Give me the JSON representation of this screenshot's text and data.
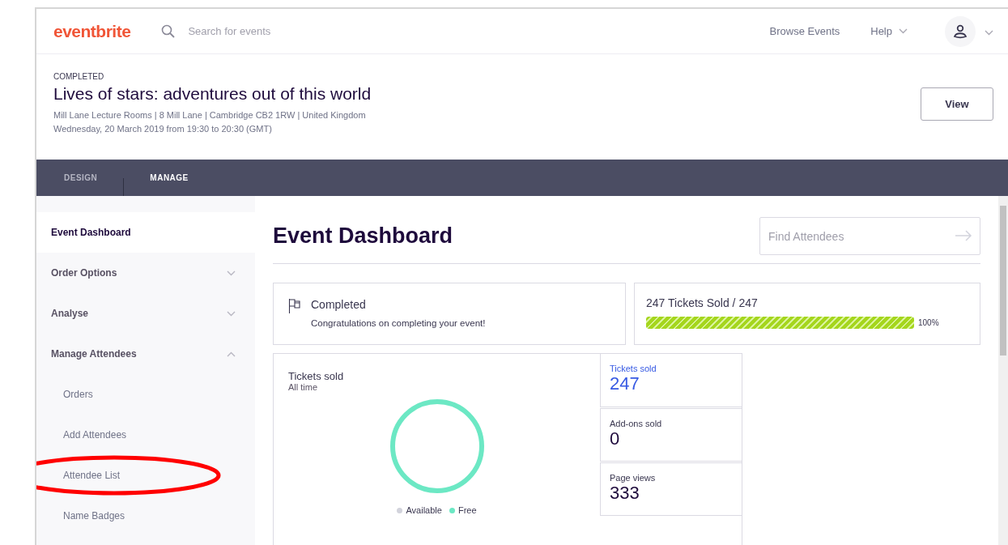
{
  "header": {
    "logo": "eventbrite",
    "search": {
      "placeholder": "Search for events"
    },
    "links": [
      {
        "label": "Browse Events",
        "dropdown": false
      },
      {
        "label": "Help",
        "dropdown": true
      }
    ]
  },
  "event": {
    "status": "COMPLETED",
    "title": "Lives of stars: adventures out of this world",
    "location": "Mill Lane Lecture Rooms | 8 Mill Lane | Cambridge CB2 1RW | United Kingdom",
    "date": "Wednesday, 20 March 2019 from 19:30 to 20:30 (GMT)",
    "view_button": "View"
  },
  "tabs": [
    {
      "label": "DESIGN",
      "selected": false
    },
    {
      "label": "MANAGE",
      "selected": true
    }
  ],
  "sidebar": {
    "items": [
      {
        "label": "Event Dashboard",
        "selected": true
      },
      {
        "label": "Order Options",
        "selected": false,
        "expanded": false
      },
      {
        "label": "Analyse",
        "selected": false,
        "expanded": false
      },
      {
        "label": "Manage Attendees",
        "selected": false,
        "expanded": true,
        "children": [
          {
            "label": "Orders",
            "selected": false,
            "circled": false
          },
          {
            "label": "Add Attendees",
            "selected": false,
            "circled": false
          },
          {
            "label": "Attendee List",
            "selected": false,
            "circled": true
          },
          {
            "label": "Name Badges",
            "selected": false,
            "circled": false
          }
        ]
      }
    ]
  },
  "main": {
    "title": "Event Dashboard",
    "find_field": {
      "placeholder": "Find Attendees"
    },
    "status_card": {
      "title": "Completed",
      "message": "Congratulations on completing your event!"
    },
    "sales_card": {
      "label": "247 Tickets Sold / 247",
      "level": 1,
      "reading": "100%"
    },
    "tickets_chart": {
      "title": "Tickets sold",
      "subtitle": "All time",
      "legend": [
        {
          "label": "Available",
          "color": "#d2d3dc"
        },
        {
          "label": "Free",
          "color": "#6ce8c4"
        }
      ]
    },
    "stats": [
      {
        "label": "Tickets sold",
        "value": "247",
        "selected": true
      },
      {
        "label": "Add-ons sold",
        "value": "0",
        "selected": false
      },
      {
        "label": "Page views",
        "value": "333",
        "selected": false
      }
    ]
  }
}
